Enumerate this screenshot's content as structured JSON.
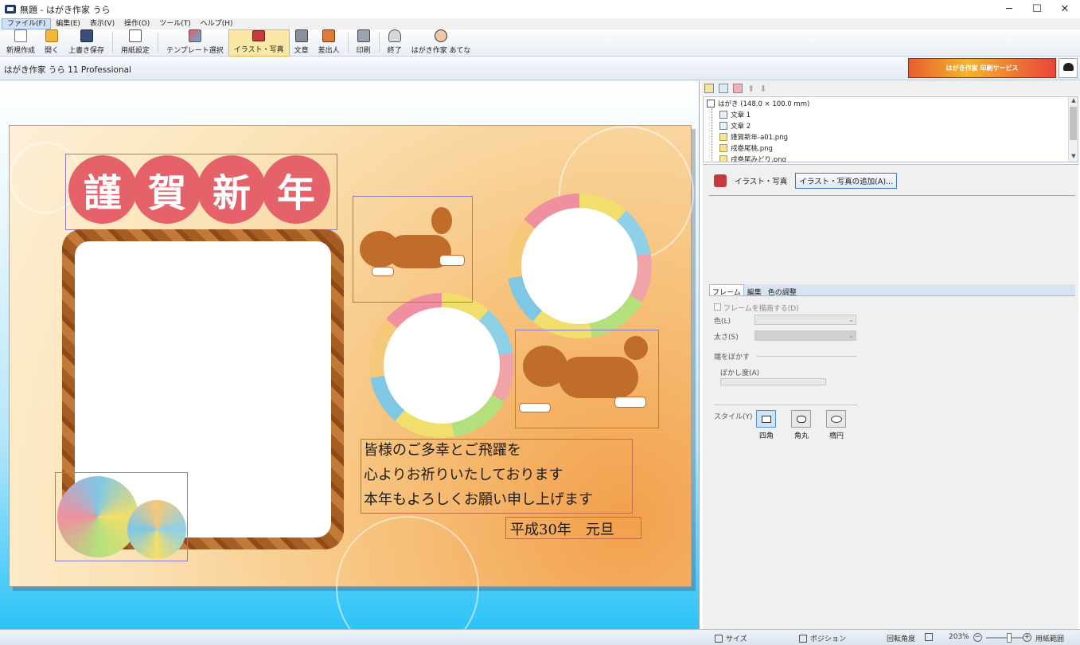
{
  "window": {
    "title": "無題 - はがき作家 うら",
    "minimize": "─",
    "maximize": "☐",
    "close": "✕"
  },
  "menu": [
    "ファイル(F)",
    "編集(E)",
    "表示(V)",
    "操作(O)",
    "ツール(T)",
    "ヘルプ(H)"
  ],
  "toolbar": {
    "new": "新規作成",
    "open": "開く",
    "save": "上書き保存",
    "paper": "用紙設定",
    "template": "テンプレート選択",
    "illust": "イラスト・写真",
    "text": "文章",
    "sender": "差出人",
    "print": "印刷",
    "exit": "終了",
    "atena": "はがき作家 あてな"
  },
  "info": {
    "product": "はがき作家 うら 11 Professional",
    "banner": "はがき作家 印刷サービス"
  },
  "card": {
    "greeting_chars": [
      "謹",
      "賀",
      "新",
      "年"
    ],
    "message_lines": [
      "皆様のご多幸とご飛躍を",
      "心よりお祈りいたしております",
      "本年もよろしくお願い申し上げます"
    ],
    "date": "平成30年　元旦"
  },
  "tree": {
    "root": "はがき (148.0 × 100.0 mm)",
    "items": [
      "文章 1",
      "文章 2",
      "謹賀新年-a01.png",
      "戌巻尾桃.png",
      "戌巻尾みどり.png"
    ]
  },
  "props": {
    "section": "イラスト・写真",
    "add_button": "イラスト・写真の追加(A)...",
    "tabs": [
      "フレーム",
      "編集",
      "色の調整"
    ],
    "draw_frame": "フレームを描画する(D)",
    "color": "色(L)",
    "thickness": "太さ(S)",
    "blur_edges": "端をぼかす",
    "blur_amount": "ぼかし度(A)",
    "style": "スタイル(Y)",
    "styles": [
      "四角",
      "角丸",
      "楕円"
    ]
  },
  "status": {
    "size": "サイズ",
    "position": "ポジション",
    "rotation": "回転角度",
    "zoom": "203%",
    "paper_range": "用紙範囲"
  }
}
